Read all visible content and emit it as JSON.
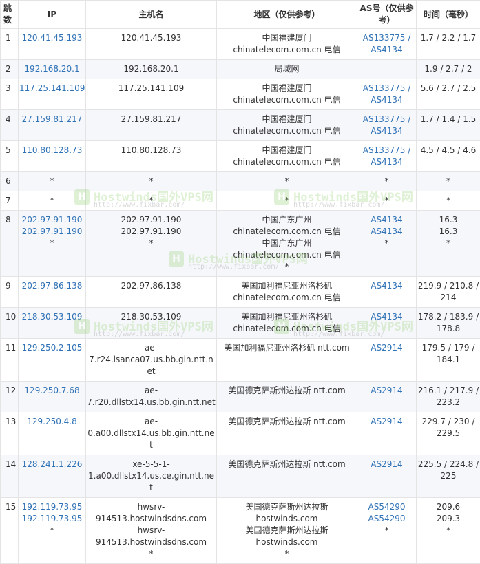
{
  "headers": {
    "hop": "跳数",
    "ip": "IP",
    "host": "主机名",
    "region": "地区（仅供参考）",
    "as": "AS号（仅供参考）",
    "time": "时间（毫秒）"
  },
  "rows": [
    {
      "hop": "1",
      "ips": [
        "120.41.45.193"
      ],
      "hosts": [
        "120.41.45.193"
      ],
      "regions": [
        "中国福建厦门",
        "chinatelecom.com.cn 电信"
      ],
      "as": [
        "AS133775 / AS4134"
      ],
      "times": [
        "1.7 / 2.2 / 1.7"
      ]
    },
    {
      "hop": "2",
      "ips": [
        "192.168.20.1"
      ],
      "hosts": [
        "192.168.20.1"
      ],
      "regions": [
        "局域网"
      ],
      "as": [],
      "times": [
        "1.9 / 2.7 / 2"
      ]
    },
    {
      "hop": "3",
      "ips": [
        "117.25.141.109"
      ],
      "hosts": [
        "117.25.141.109"
      ],
      "regions": [
        "中国福建厦门",
        "chinatelecom.com.cn 电信"
      ],
      "as": [
        "AS133775 / AS4134"
      ],
      "times": [
        "5.6 / 2.7 / 2.5"
      ]
    },
    {
      "hop": "4",
      "ips": [
        "27.159.81.217"
      ],
      "hosts": [
        "27.159.81.217"
      ],
      "regions": [
        "中国福建厦门",
        "chinatelecom.com.cn 电信"
      ],
      "as": [
        "AS133775 / AS4134"
      ],
      "times": [
        "1.7 / 1.4 / 1.5"
      ]
    },
    {
      "hop": "5",
      "ips": [
        "110.80.128.73"
      ],
      "hosts": [
        "110.80.128.73"
      ],
      "regions": [
        "中国福建厦门",
        "chinatelecom.com.cn 电信"
      ],
      "as": [
        "AS133775 / AS4134"
      ],
      "times": [
        "4.5 / 4.5 / 4.6"
      ]
    },
    {
      "hop": "6",
      "ips": [
        "*"
      ],
      "hosts": [
        "*"
      ],
      "regions": [
        "*"
      ],
      "as": [
        "*"
      ],
      "times": [
        "*"
      ]
    },
    {
      "hop": "7",
      "ips": [
        "*"
      ],
      "hosts": [
        "*"
      ],
      "regions": [
        "*"
      ],
      "as": [
        "*"
      ],
      "times": [
        "*"
      ]
    },
    {
      "hop": "8",
      "ips": [
        "202.97.91.190",
        "202.97.91.190",
        "*"
      ],
      "hosts": [
        "202.97.91.190",
        "202.97.91.190",
        "*"
      ],
      "regions": [
        "中国广东广州",
        "chinatelecom.com.cn 电信",
        "中国广东广州",
        "chinatelecom.com.cn 电信",
        "*"
      ],
      "as": [
        "AS4134",
        "AS4134",
        "*"
      ],
      "times": [
        "16.3",
        "16.3",
        "*"
      ]
    },
    {
      "hop": "9",
      "ips": [
        "202.97.86.138"
      ],
      "hosts": [
        "202.97.86.138"
      ],
      "regions": [
        "美国加利福尼亚州洛杉矶",
        "chinatelecom.com.cn 电信"
      ],
      "as": [
        "AS4134"
      ],
      "times": [
        "219.9 / 210.8 / 214"
      ]
    },
    {
      "hop": "10",
      "ips": [
        "218.30.53.109"
      ],
      "hosts": [
        "218.30.53.109"
      ],
      "regions": [
        "美国加利福尼亚州洛杉矶",
        "chinatelecom.com.cn 电信"
      ],
      "as": [
        "AS4134"
      ],
      "times": [
        "178.2 / 183.9 / 178.8"
      ]
    },
    {
      "hop": "11",
      "ips": [
        "129.250.2.105"
      ],
      "hosts": [
        "ae-7.r24.lsanca07.us.bb.gin.ntt.net"
      ],
      "regions": [
        "美国加利福尼亚州洛杉矶 ntt.com"
      ],
      "as": [
        "AS2914"
      ],
      "times": [
        "179.5 / 179 / 184.1"
      ]
    },
    {
      "hop": "12",
      "ips": [
        "129.250.7.68"
      ],
      "hosts": [
        "ae-7.r20.dllstx14.us.bb.gin.ntt.net"
      ],
      "regions": [
        "美国德克萨斯州达拉斯 ntt.com"
      ],
      "as": [
        "AS2914"
      ],
      "times": [
        "216.1 / 217.9 / 223.2"
      ]
    },
    {
      "hop": "13",
      "ips": [
        "129.250.4.8"
      ],
      "hosts": [
        "ae-0.a00.dllstx14.us.bb.gin.ntt.net"
      ],
      "regions": [
        "美国德克萨斯州达拉斯 ntt.com"
      ],
      "as": [
        "AS2914"
      ],
      "times": [
        "229.7 / 230 / 229.5"
      ]
    },
    {
      "hop": "14",
      "ips": [
        "128.241.1.226"
      ],
      "hosts": [
        "xe-5-5-1-1.a00.dllstx14.us.ce.gin.ntt.net"
      ],
      "regions": [
        "美国德克萨斯州达拉斯 ntt.com"
      ],
      "as": [
        "AS2914"
      ],
      "times": [
        "225.5 / 224.8 / 225"
      ]
    },
    {
      "hop": "15",
      "ips": [
        "192.119.73.95",
        "192.119.73.95",
        "*"
      ],
      "hosts": [
        "hwsrv-914513.hostwindsdns.com",
        "hwsrv-914513.hostwindsdns.com",
        "*"
      ],
      "regions": [
        "美国德克萨斯州达拉斯",
        "hostwinds.com",
        "美国德克萨斯州达拉斯",
        "hostwinds.com",
        "*"
      ],
      "as": [
        "AS54290",
        "AS54290",
        "*"
      ],
      "times": [
        "209.6",
        "209.3",
        "*"
      ]
    }
  ],
  "watermark": {
    "title": "Hostwinds国外VPS网",
    "url": "http://www.fixbar.com/",
    "logo_text": "H",
    "accent_color": "#8fcf6b"
  },
  "colors": {
    "link": "#2f72b6",
    "border": "#e4e4e4",
    "alt_row": "#f6f7fb"
  }
}
